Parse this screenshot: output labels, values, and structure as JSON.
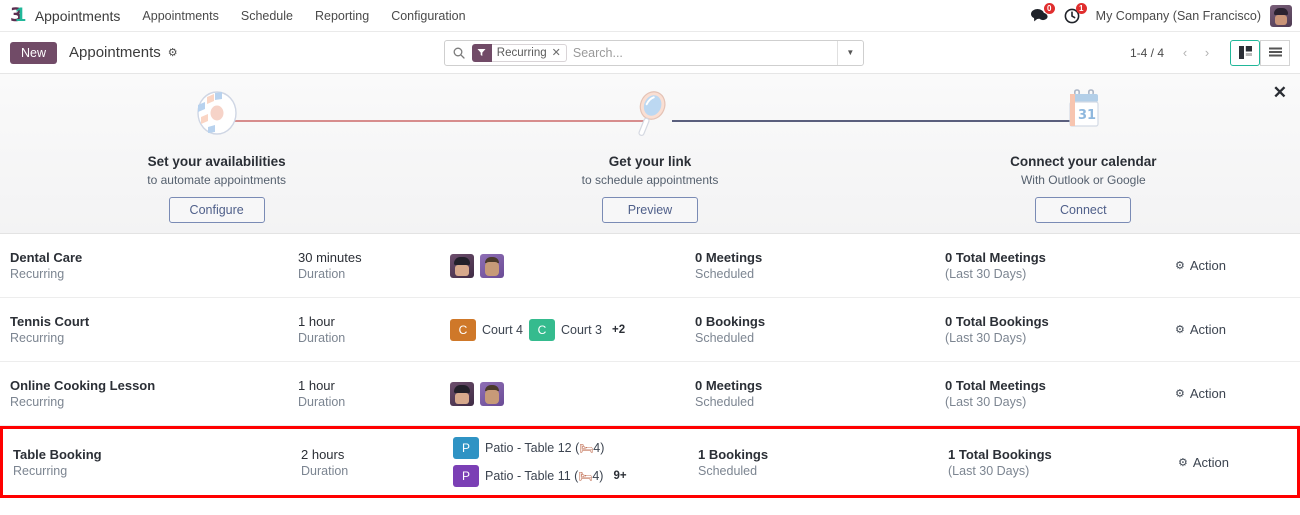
{
  "navbar": {
    "brand": "3",
    "brand_accent": "1",
    "app_name": "Appointments",
    "menu": [
      {
        "label": "Appointments"
      },
      {
        "label": "Schedule"
      },
      {
        "label": "Reporting"
      },
      {
        "label": "Configuration"
      }
    ],
    "messages_badge": "0",
    "activities_badge": "1",
    "company": "My Company (San Francisco)",
    "messages_icon": "chat-bubble-icon",
    "activities_icon": "clock-icon",
    "avatar_icon": "user-avatar"
  },
  "control_panel": {
    "new_label": "New",
    "breadcrumb": "Appointments",
    "gear_icon": "gear-icon",
    "search": {
      "icon": "search-icon",
      "facet_label": "Recurring",
      "facet_icon": "filter-icon",
      "facet_remove": "✕",
      "placeholder": "Search...",
      "value": "",
      "dropdown_icon": "chevron-down-icon"
    },
    "pager": {
      "range": "1-4 / 4",
      "prev_icon": "chevron-left-icon",
      "next_icon": "chevron-right-icon"
    },
    "views": {
      "kanban": "kanban-view-icon",
      "list": "list-view-icon",
      "active": "kanban"
    }
  },
  "onboarding": {
    "close_icon": "close-icon",
    "steps": [
      {
        "illustration": "gear-illustration",
        "title": "Set your availabilities",
        "subtitle": "to automate appointments",
        "button": "Configure"
      },
      {
        "illustration": "magnifier-illustration",
        "title": "Get your link",
        "subtitle": "to schedule appointments",
        "button": "Preview"
      },
      {
        "illustration": "calendar-illustration",
        "title": "Connect your calendar",
        "subtitle": "With Outlook or Google",
        "button": "Connect"
      }
    ],
    "calendar_day": "31",
    "connector_left_color": "#d78d8d",
    "connector_right_color": "#5a5f7d"
  },
  "rows": [
    {
      "name": "Dental Care",
      "type": "Recurring",
      "duration": "30 minutes",
      "duration_label": "Duration",
      "resources_kind": "avatars",
      "resources": [],
      "scheduled_value": "0 Meetings",
      "scheduled_label": "Scheduled",
      "total_value": "0 Total Meetings",
      "total_label": "(Last 30 Days)",
      "action": "Action",
      "highlighted": false
    },
    {
      "name": "Tennis Court",
      "type": "Recurring",
      "duration": "1 hour",
      "duration_label": "Duration",
      "resources_kind": "chips-inline",
      "resources": [
        {
          "initial": "C",
          "label": "Court 4",
          "color": "#cf7829"
        },
        {
          "initial": "C",
          "label": "Court 3",
          "color": "#35bb8e"
        }
      ],
      "more": "+2",
      "scheduled_value": "0 Bookings",
      "scheduled_label": "Scheduled",
      "total_value": "0 Total Bookings",
      "total_label": "(Last 30 Days)",
      "action": "Action",
      "highlighted": false
    },
    {
      "name": "Online Cooking Lesson",
      "type": "Recurring",
      "duration": "1 hour",
      "duration_label": "Duration",
      "resources_kind": "avatars",
      "resources": [],
      "scheduled_value": "0 Meetings",
      "scheduled_label": "Scheduled",
      "total_value": "0 Total Meetings",
      "total_label": "(Last 30 Days)",
      "action": "Action",
      "highlighted": false
    },
    {
      "name": "Table Booking",
      "type": "Recurring",
      "duration": "2 hours",
      "duration_label": "Duration",
      "resources_kind": "chips-stacked",
      "resources": [
        {
          "initial": "P",
          "label": "Patio - Table 12 (",
          "seats": "4",
          "suffix": ")",
          "color": "#2f93c4"
        },
        {
          "initial": "P",
          "label": "Patio - Table 11 (",
          "seats": "4",
          "suffix": ")",
          "color": "#7b3fb5"
        }
      ],
      "more": "9+",
      "seat_icon": "chair-icon",
      "scheduled_value": "1 Bookings",
      "scheduled_label": "Scheduled",
      "total_value": "1 Total Bookings",
      "total_label": "(Last 30 Days)",
      "action": "Action",
      "highlighted": true
    }
  ]
}
